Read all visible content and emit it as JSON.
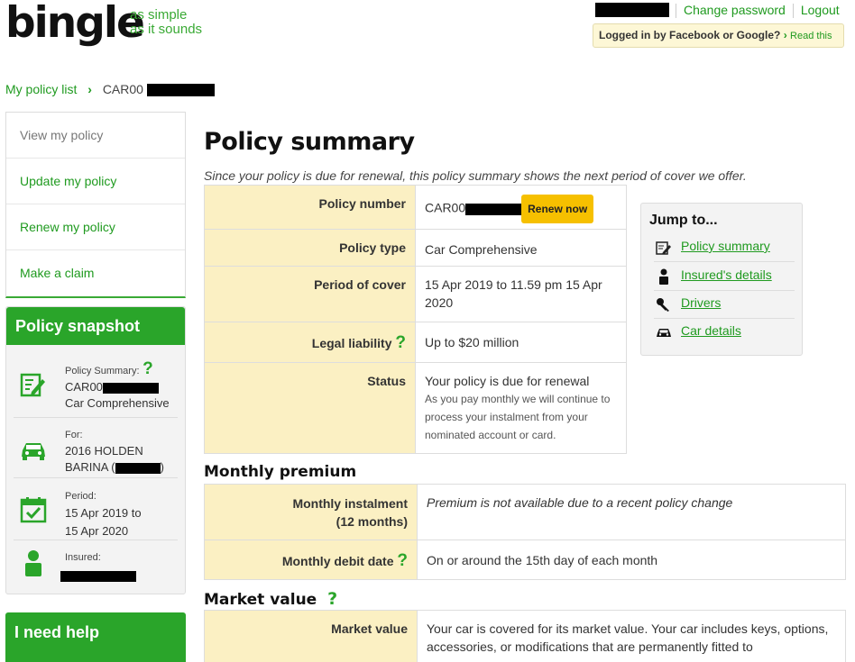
{
  "header": {
    "logo": "bingle",
    "tagline_line1": "as simple",
    "tagline_line2": "as it sounds",
    "change_password": "Change password",
    "logout": "Logout",
    "fb_text": "Logged in by Facebook or Google?",
    "fb_read": "Read this"
  },
  "breadcrumb": {
    "root": "My policy list",
    "current": "CAR00"
  },
  "leftnav": {
    "items": [
      {
        "label": "View my policy"
      },
      {
        "label": "Update my policy"
      },
      {
        "label": "Renew my policy"
      },
      {
        "label": "Make a claim"
      }
    ]
  },
  "snapshot": {
    "title": "Policy snapshot",
    "summary_label": "Policy Summary:",
    "summary_number": "CAR00",
    "summary_type": "Car Comprehensive",
    "for_label": "For:",
    "for_line1": "2016 HOLDEN",
    "for_line2": "BARINA (",
    "for_line2_end": ")",
    "period_label": "Period:",
    "period_line1": "15 Apr 2019 to",
    "period_line2": "15 Apr 2020",
    "insured_label": "Insured:"
  },
  "help": {
    "title": "I need help"
  },
  "main": {
    "title": "Policy summary",
    "intro": "Since your policy is due for renewal, this policy summary shows the next period of cover we offer.",
    "policy_number_label": "Policy number",
    "policy_number": "CAR00",
    "renew_label": "Renew now",
    "policy_type_label": "Policy type",
    "policy_type": "Car Comprehensive",
    "period_label": "Period of cover",
    "period_value": "15 Apr 2019 to 11.59 pm 15 Apr 2020",
    "liability_label": "Legal liability",
    "liability_value": "Up to $20 million",
    "status_label": "Status",
    "status_value": "Your policy is due for renewal",
    "status_note": "As you pay monthly we will continue to process your instalment from your nominated account or card.",
    "monthly_title": "Monthly premium",
    "instalment_label_1": "Monthly instalment",
    "instalment_label_2": "(12 months)",
    "instalment_value": "Premium is not available due to a recent policy change",
    "debit_label": "Monthly debit date",
    "debit_value": "On or around the 15th day of each month",
    "market_title": "Market value",
    "market_label": "Market value",
    "market_value": "Your car is covered for its market value. Your car includes keys, options, accessories, or modifications that are permanently fitted to"
  },
  "jump": {
    "title": "Jump to...",
    "links": [
      {
        "label": "Policy summary",
        "icon": "edit-icon"
      },
      {
        "label": "Insured's details",
        "icon": "person-icon"
      },
      {
        "label": "Drivers",
        "icon": "key-icon"
      },
      {
        "label": "Car details",
        "icon": "car-icon"
      }
    ]
  },
  "colors": {
    "brand_green": "#2aa52a",
    "link_green": "#1f9a1f",
    "row_label_bg": "#fbf0c3",
    "renew_button": "#f6c000"
  }
}
